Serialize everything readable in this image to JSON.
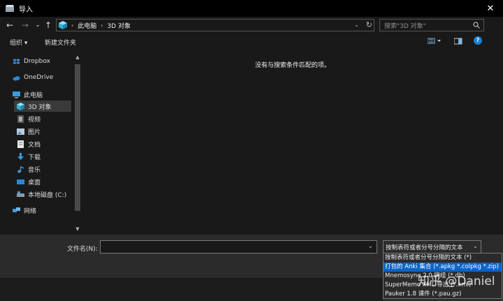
{
  "window": {
    "title": "导入",
    "close_glyph": "✕"
  },
  "nav": {
    "back_glyph": "←",
    "forward_glyph": "→",
    "recent_glyph": "⌄",
    "up_glyph": "↑",
    "breadcrumbs": [
      "此电脑",
      "3D 对象"
    ],
    "crumb_separator": "›",
    "refresh_glyph": "↻",
    "search_placeholder": "搜索\"3D 对象\""
  },
  "toolbar": {
    "organize": "组织 ▾",
    "new_folder": "新建文件夹",
    "help_glyph": "?"
  },
  "sidebar": {
    "items": [
      {
        "label": "Dropbox",
        "icon": "dropbox-icon"
      },
      {
        "label": "OneDrive",
        "icon": "cloud-icon"
      },
      {
        "label": "此电脑",
        "icon": "computer-icon"
      },
      {
        "label": "3D 对象",
        "icon": "cube-icon"
      },
      {
        "label": "视频",
        "icon": "video-icon"
      },
      {
        "label": "图片",
        "icon": "picture-icon"
      },
      {
        "label": "文档",
        "icon": "document-icon"
      },
      {
        "label": "下载",
        "icon": "download-icon"
      },
      {
        "label": "音乐",
        "icon": "music-icon"
      },
      {
        "label": "桌面",
        "icon": "desktop-icon"
      },
      {
        "label": "本地磁盘 (C:)",
        "icon": "drive-icon"
      },
      {
        "label": "网络",
        "icon": "network-icon"
      }
    ],
    "selected": "3D 对象"
  },
  "content": {
    "empty_message": "没有与搜索条件匹配的项。"
  },
  "bottom": {
    "filename_label": "文件名(N):",
    "filename_value": "",
    "filter_selected": "按制表符或者分号分隔的文本",
    "filter_options": [
      "按制表符或者分号分隔的文本 (*)",
      "打包的 Anki 集合 (*.apkg *.colpkg *.zip)",
      "Mnemosyne 2.0 牌组 (*.db)",
      "SuperMemo XML 导出 (*.xml)",
      "Pauker 1.8 课件 (*.pau.gz)"
    ],
    "highlighted_option_index": 1
  },
  "watermark": "知乎 @Daniel",
  "colors": {
    "highlight": "#0a64c8",
    "folder_blue": "#4aa3df",
    "background": "#191919"
  }
}
